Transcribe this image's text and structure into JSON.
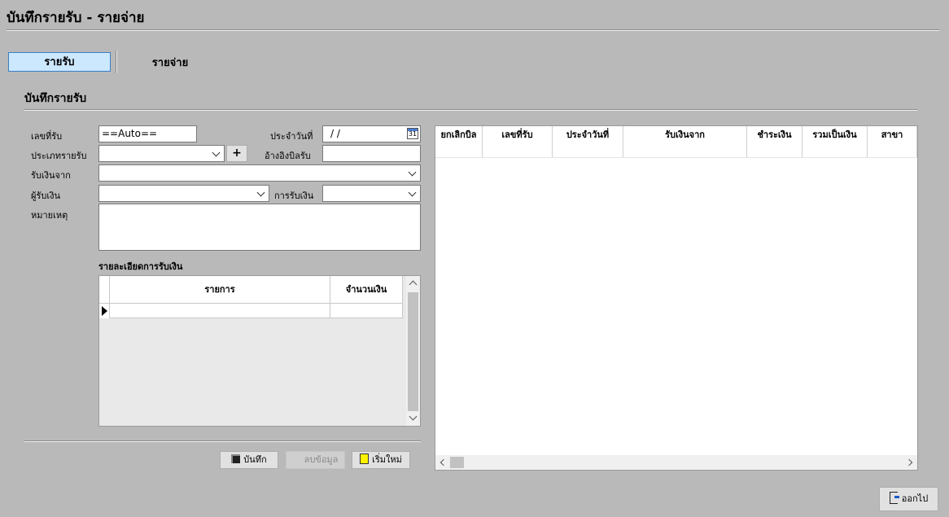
{
  "page": {
    "title": "บันทึกรายรับ - รายจ่าย"
  },
  "tabs": {
    "income": "รายรับ",
    "expense": "รายจ่าย"
  },
  "section": {
    "title": "บันทึกรายรับ"
  },
  "form": {
    "receipt_no_label": "เลขที่รับ",
    "receipt_no_value": "==Auto==",
    "date_label": "ประจำวันที่",
    "date_value": " /  /",
    "calendar_day": "31",
    "income_type_label": "ประเภทรายรับ",
    "add_label": "+",
    "ref_label": "อ้างอิงบิลรับ",
    "received_from_label": "รับเงินจาก",
    "receiver_label": "ผู้รับเงิน",
    "payment_method_label": "การรับเงิน",
    "note_label": "หมายเหตุ"
  },
  "details": {
    "title": "รายละเอียดการรับเงิน",
    "columns": [
      "รายการ",
      "จำนวนเงิน"
    ]
  },
  "buttons": {
    "save": "บันทึก",
    "delete": "ลบข้อมูล",
    "new": "เริ่มใหม่",
    "exit": "ออกไป"
  },
  "list": {
    "columns": [
      "ยกเลิกบิล",
      "เลขที่รับ",
      "ประจำวันที่",
      "รับเงินจาก",
      "ชำระเงิน",
      "รวมเป็นเงิน",
      "สาขา"
    ]
  }
}
